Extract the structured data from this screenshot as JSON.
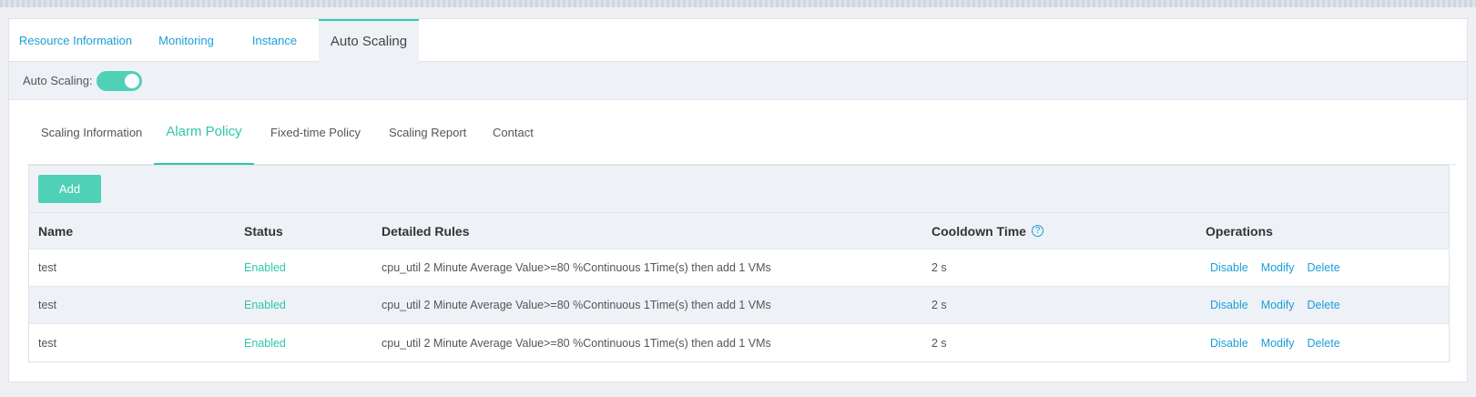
{
  "main_tabs": [
    {
      "label": "Resource Information"
    },
    {
      "label": "Monitoring"
    },
    {
      "label": "Instance"
    },
    {
      "label": "Auto Scaling"
    }
  ],
  "auto_scaling": {
    "label": "Auto Scaling:",
    "enabled": true
  },
  "sub_tabs": [
    {
      "label": "Scaling Information"
    },
    {
      "label": "Alarm Policy"
    },
    {
      "label": "Fixed-time Policy"
    },
    {
      "label": "Scaling Report"
    },
    {
      "label": "Contact"
    }
  ],
  "toolbar": {
    "add_label": "Add"
  },
  "table": {
    "headers": {
      "name": "Name",
      "status": "Status",
      "rules": "Detailed Rules",
      "cooldown": "Cooldown Time",
      "operations": "Operations"
    },
    "rows": [
      {
        "name": "test",
        "status": "Enabled",
        "rules": "cpu_util 2 Minute Average Value>=80 %Continuous 1Time(s) then add 1 VMs",
        "cooldown": "2 s"
      },
      {
        "name": "test",
        "status": "Enabled",
        "rules": "cpu_util 2 Minute Average Value>=80 %Continuous 1Time(s) then add 1 VMs",
        "cooldown": "2 s"
      },
      {
        "name": "test",
        "status": "Enabled",
        "rules": "cpu_util 2 Minute Average Value>=80 %Continuous 1Time(s) then add 1 VMs",
        "cooldown": "2 s"
      }
    ],
    "operations": {
      "disable": "Disable",
      "modify": "Modify",
      "delete": "Delete"
    }
  },
  "colors": {
    "accent": "#4fd1b7",
    "link": "#1a9fd9",
    "enabled": "#2ec7ab"
  },
  "icons": {
    "cooldown_help": "help-circle-icon"
  }
}
